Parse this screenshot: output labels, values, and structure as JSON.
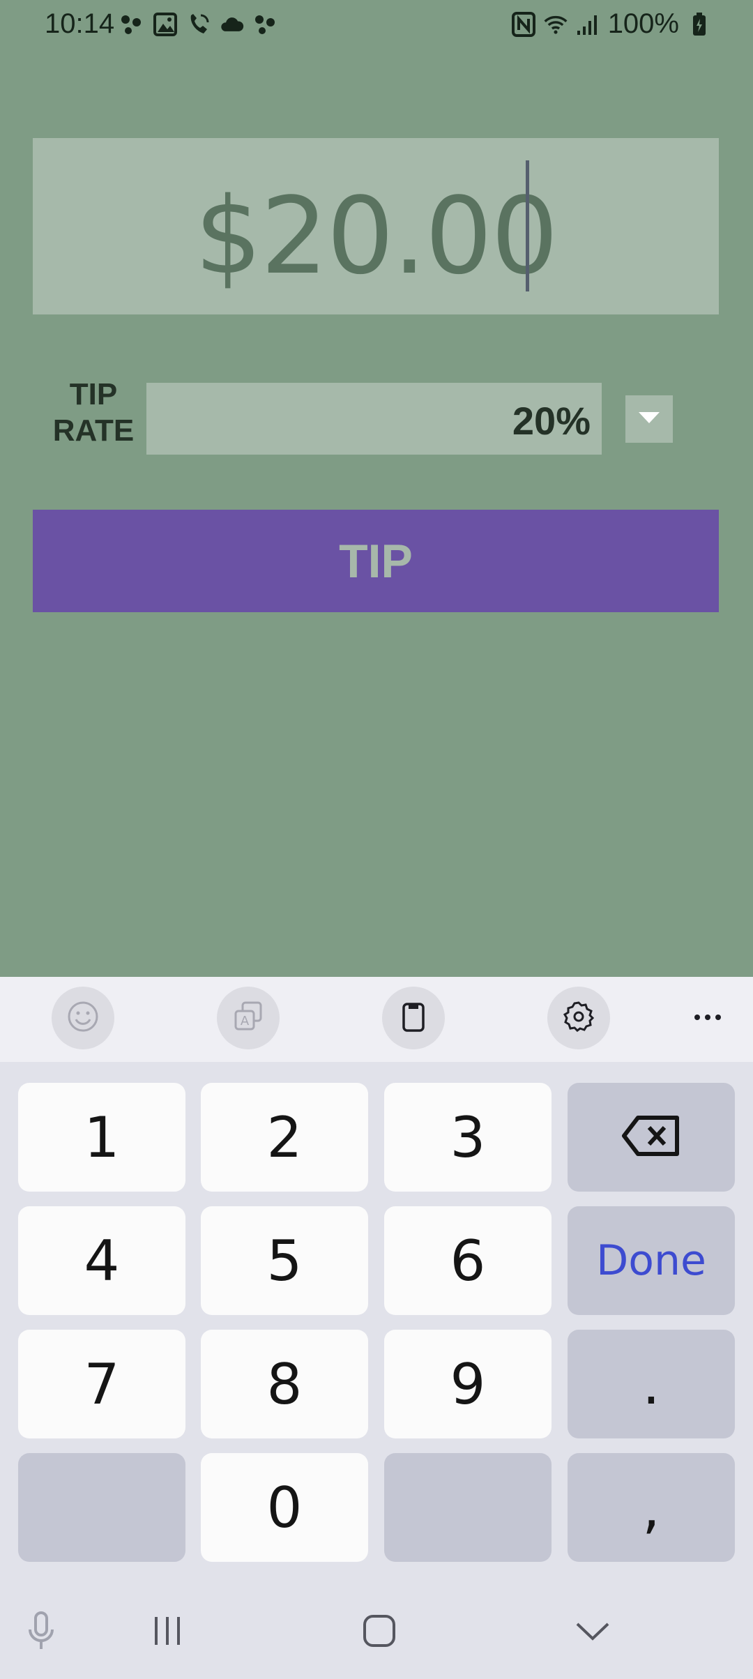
{
  "status_bar": {
    "time": "10:14",
    "battery": "100%"
  },
  "bill": {
    "amount": "$20.00"
  },
  "tip_rate": {
    "label_line1": "TIP",
    "label_line2": "RATE",
    "value": "20%"
  },
  "tip_button": {
    "label": "TIP"
  },
  "keyboard": {
    "keys": {
      "k1": "1",
      "k2": "2",
      "k3": "3",
      "k4": "4",
      "k5": "5",
      "k6": "6",
      "k7": "7",
      "k8": "8",
      "k9": "9",
      "k0": "0",
      "done": "Done",
      "period": ".",
      "comma": ","
    }
  },
  "colors": {
    "background": "#7f9c85",
    "field": "#a6b9aa",
    "tip_button": "#6a52a4",
    "done_text": "#3d4bd0"
  }
}
